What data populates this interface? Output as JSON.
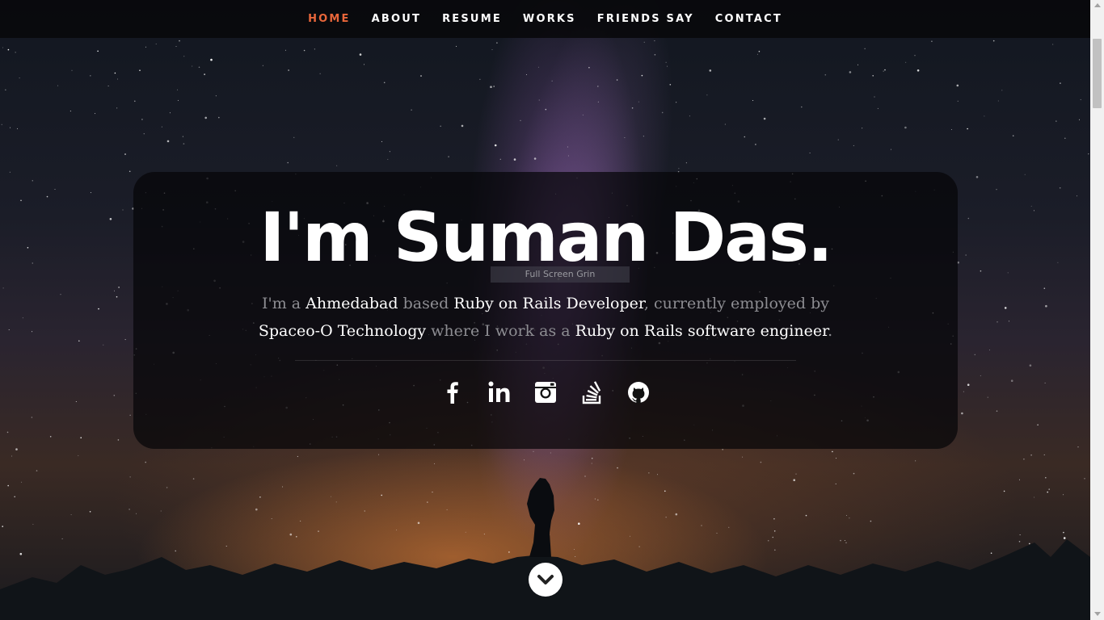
{
  "nav": {
    "items": [
      {
        "label": "HOME",
        "active": true
      },
      {
        "label": "ABOUT",
        "active": false
      },
      {
        "label": "RESUME",
        "active": false
      },
      {
        "label": "WORKS",
        "active": false
      },
      {
        "label": "FRIENDS SAY",
        "active": false
      },
      {
        "label": "CONTACT",
        "active": false
      }
    ],
    "active_color": "#e8663a"
  },
  "hero": {
    "headline": "I'm Suman Das.",
    "tooltip": "Full Screen Grin",
    "intro": {
      "t1": "I'm a ",
      "city": "Ahmedabad",
      "t2": " based ",
      "role": "Ruby on Rails Developer",
      "t3": ", currently employed by ",
      "company": "Spaceo-O Technology",
      "t4": " where I work as a ",
      "position": "Ruby on Rails software engineer",
      "t5": "."
    }
  },
  "social": [
    {
      "name": "facebook-icon"
    },
    {
      "name": "linkedin-icon"
    },
    {
      "name": "instagram-icon"
    },
    {
      "name": "stackoverflow-icon"
    },
    {
      "name": "github-icon"
    }
  ],
  "scroll_down": {
    "icon": "chevron-down-icon"
  }
}
